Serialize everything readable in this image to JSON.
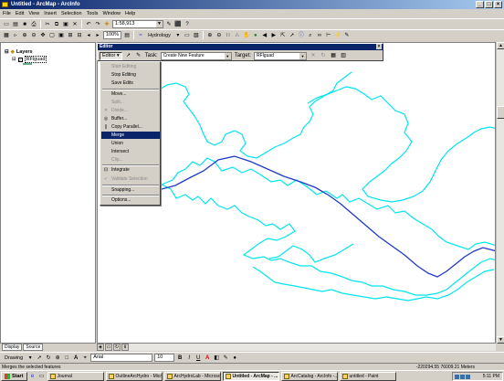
{
  "window": {
    "title": "Untitled - ArcMap - ArcInfo",
    "controls": [
      "_",
      "□",
      "×"
    ]
  },
  "menu": [
    "File",
    "Edit",
    "View",
    "Insert",
    "Selection",
    "Tools",
    "Window",
    "Help"
  ],
  "toolbar": {
    "scale": "1:58,913",
    "zoom_percent": "100%",
    "hydrology_label": "Hydrology"
  },
  "toc": {
    "root_label": "Layers",
    "layer_name": "RFlguad",
    "tabs": [
      "Display",
      "Source"
    ]
  },
  "editor_toolbar": {
    "caption": "Editor",
    "menu_label": "Editor",
    "task_label": "Task:",
    "task_value": "Create New Feature",
    "target_label": "Target:",
    "target_value": "RFlguad"
  },
  "editor_menu": {
    "items": [
      {
        "label": "Start Editing",
        "enabled": false
      },
      {
        "label": "Stop Editing",
        "enabled": true
      },
      {
        "label": "Save Edits",
        "enabled": true
      },
      {
        "label": "Move...",
        "enabled": true
      },
      {
        "label": "Split...",
        "enabled": false
      },
      {
        "label": "Divide...",
        "enabled": false
      },
      {
        "label": "Buffer...",
        "enabled": true
      },
      {
        "label": "Copy Parallel...",
        "enabled": true
      },
      {
        "label": "Merge",
        "enabled": true,
        "highlighted": true
      },
      {
        "label": "Union",
        "enabled": true
      },
      {
        "label": "Intersect",
        "enabled": true
      },
      {
        "label": "Clip...",
        "enabled": false
      },
      {
        "label": "Integrate",
        "enabled": true
      },
      {
        "label": "Validate Selection",
        "enabled": false
      },
      {
        "label": "Snapping...",
        "enabled": true
      },
      {
        "label": "Options...",
        "enabled": true
      }
    ]
  },
  "draw_toolbar": {
    "label": "Drawing",
    "font": "Arial",
    "size": "10"
  },
  "status": {
    "message": "Merges the selected features",
    "coords": "-220294.55  76009.21 Meters"
  },
  "taskbar": {
    "start": "Start",
    "items": [
      "Journal",
      "OutlineArcHydro - Micr...",
      "ArcHydroLab - Microso...",
      "Untitled - ArcMap - ...",
      "ArcCatalog - ArcInfo -...",
      "untitled - Paint"
    ],
    "active_index": 3,
    "clock": "5:11 PM"
  },
  "colors": {
    "polygon": "#00e5ee",
    "stream": "#1f3ac8",
    "highlight": "#0a246a"
  }
}
